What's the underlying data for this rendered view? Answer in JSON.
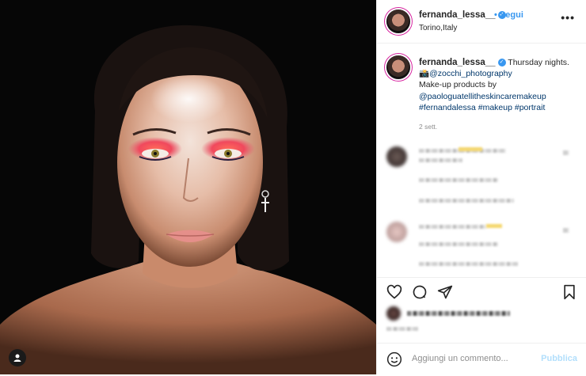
{
  "post": {
    "username": "fernanda_lessa__",
    "location": "Torino,Italy",
    "follow_label": "Segui",
    "bullet": "•",
    "verified_mark": "✓",
    "more_label": "•••",
    "caption": {
      "username": "fernanda_lessa__",
      "first_text": "Thursday nights.",
      "camera_emoji": "📸",
      "photographer": "@zocchi_photography",
      "line3": "Make-up products by",
      "brand": "@paologuatellitheskincaremakeup",
      "hashtags": [
        "#fernandalessa",
        "#makeup",
        "#portrait"
      ],
      "time": "2 sett."
    }
  },
  "actions": {
    "like_icon": "heart-icon",
    "comment_icon": "comment-icon",
    "share_icon": "share-icon",
    "save_icon": "bookmark-icon"
  },
  "comment_box": {
    "placeholder": "Aggiungi un commento...",
    "publish_label": "Pubblica"
  },
  "colors": {
    "accent_blue": "#3897f0",
    "link": "#00376b",
    "muted": "#8e8e8e",
    "publish_disabled": "#b2dffc"
  }
}
